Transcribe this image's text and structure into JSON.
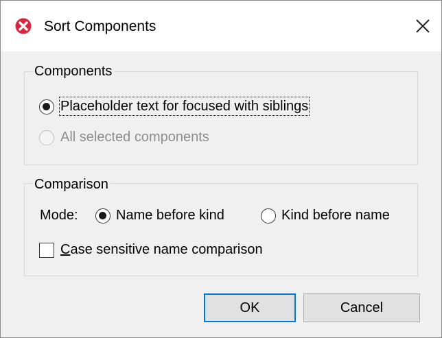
{
  "window": {
    "title": "Sort Components",
    "app_icon": "altova-x-icon",
    "close_icon": "close-icon",
    "colors": {
      "app_icon": "#d7263d",
      "default_button_border": "#0078d7"
    }
  },
  "components_group": {
    "legend": "Components",
    "options": [
      {
        "label": "Placeholder text for focused with siblings",
        "checked": true,
        "enabled": true
      },
      {
        "label": "All selected components",
        "checked": false,
        "enabled": false
      }
    ]
  },
  "comparison_group": {
    "legend": "Comparison",
    "mode_label": "Mode:",
    "mode_options": [
      {
        "label": "Name before kind",
        "checked": true
      },
      {
        "label": "Kind before name",
        "checked": false
      }
    ],
    "case_sensitive": {
      "mnemonic": "C",
      "label_rest": "ase sensitive name comparison",
      "checked": false
    }
  },
  "buttons": {
    "ok": "OK",
    "cancel": "Cancel"
  }
}
